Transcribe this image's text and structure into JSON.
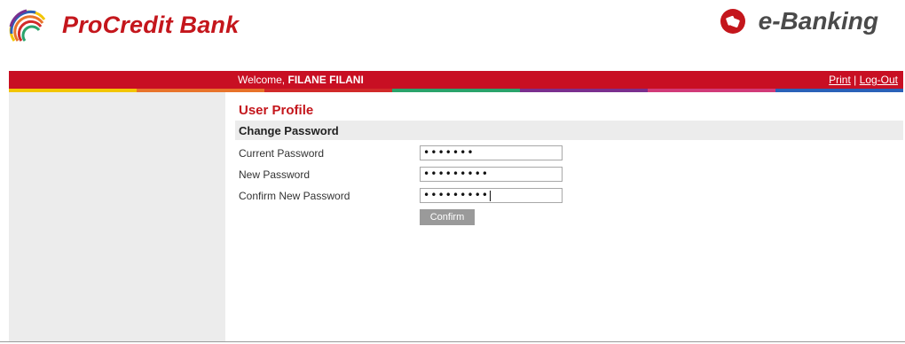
{
  "brand": {
    "bank_name": "ProCredit Bank",
    "ebanking_label": "e-Banking",
    "primary_color": "#c4161c",
    "logo_icon": "procredit-arcs-logo-icon",
    "ebanking_icon": "ebanking-badge-icon"
  },
  "header": {
    "welcome_prefix": "Welcome,",
    "user_name": "FILANE FILANI",
    "print_label": "Print",
    "separator": "|",
    "logout_label": "Log-Out",
    "bar_color": "#c80f23",
    "stripe_colors": [
      "#f2c500",
      "#e8732a",
      "#d12a2a",
      "#2aa36b",
      "#7a2f8e",
      "#d13a78",
      "#2a62b8"
    ]
  },
  "page": {
    "title": "User Profile",
    "section_title": "Change Password"
  },
  "form": {
    "fields": [
      {
        "label": "Current Password",
        "value": "•••••••"
      },
      {
        "label": "New Password",
        "value": "•••••••••"
      },
      {
        "label": "Confirm New Password",
        "value": "•••••••••"
      }
    ],
    "confirm_label": "Confirm"
  }
}
